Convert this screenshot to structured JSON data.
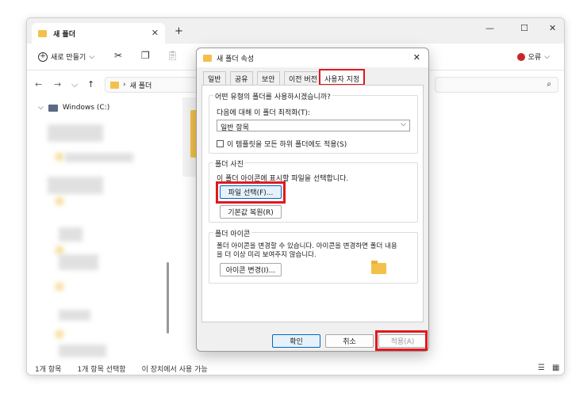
{
  "explorer": {
    "tab_title": "새 폴더",
    "tab_close": "✕",
    "new_tab": "+",
    "window_controls": [
      "—",
      "☐",
      "✕"
    ],
    "new_button_label": "새로 만들기",
    "new_button_chevron": "⌵",
    "toolbar_icons": [
      "cut-icon",
      "copy-icon",
      "paste-icon"
    ],
    "error_label": "오류",
    "address_path_sep": "›",
    "address_path": "새 폴더",
    "nav_drive": "Windows (C:)",
    "status": {
      "items": "1개 항목",
      "selected": "1개 항목 선택함",
      "availability": "이 장치에서 사용 가능"
    }
  },
  "dialog": {
    "title": "새 폴더 속성",
    "close": "✕",
    "tabs": [
      "일반",
      "공유",
      "보안",
      "이전 버전",
      "사용자 지정"
    ],
    "active_tab": "사용자 지정",
    "group1": {
      "label": "어떤 유형의 폴더를 사용하시겠습니까?",
      "optimize_label": "다음에 대해 이 폴더 최적화(T):",
      "select_value": "일반 항목",
      "checkbox_label": "이 템플릿을 모든 하위 폴더에도 적용(S)"
    },
    "group2": {
      "label": "폴더 사진",
      "desc": "이 폴더 아이콘에 표시할 파일을 선택합니다.",
      "choose_file": "파일 선택(F)...",
      "restore_default": "기본값 복원(R)"
    },
    "group3": {
      "label": "폴더 아이콘",
      "desc_line1": "폴더 아이콘을 변경할 수 있습니다. 아이콘을 변경하면 폴더 내용",
      "desc_line2": "을 더 이상  미리 보여주지 않습니다.",
      "change_icon": "아이콘 변경(I)..."
    },
    "footer": {
      "ok": "확인",
      "cancel": "취소",
      "apply": "적용(A)"
    }
  },
  "colors": {
    "highlight": "#e0191f",
    "folder": "#f3c14a",
    "accent": "#0067c0"
  }
}
